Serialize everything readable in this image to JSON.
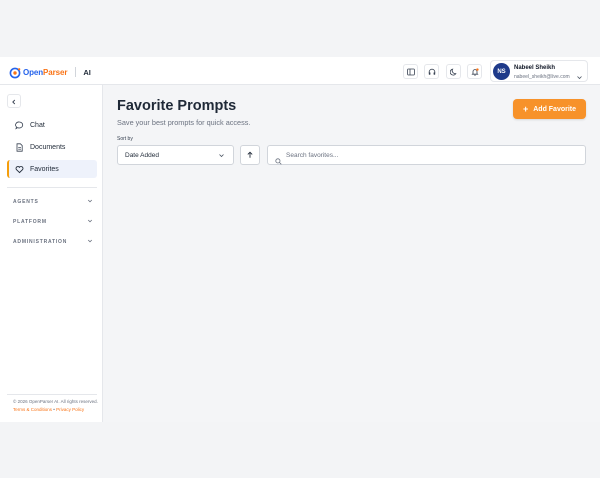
{
  "brand": {
    "name_open": "Open",
    "name_parser": "Parser",
    "suffix": "AI"
  },
  "header": {
    "icons": [
      "layout-icon",
      "headset-icon",
      "moon-icon",
      "notification-bell-icon"
    ],
    "user": {
      "initials": "NS",
      "name": "Nabeel Sheikh",
      "email": "nabeel_sheikh@live.com"
    }
  },
  "sidebar": {
    "items": [
      {
        "label": "Chat",
        "icon": "chat-bubble-icon"
      },
      {
        "label": "Documents",
        "icon": "document-icon"
      },
      {
        "label": "Favorites",
        "icon": "heart-icon",
        "active": true
      }
    ],
    "sections": [
      {
        "label": "AGENTS"
      },
      {
        "label": "PLATFORM"
      },
      {
        "label": "ADMINISTRATION"
      }
    ],
    "footer": {
      "copyright": "© 2026 OpenParser AI. All rights reserved.",
      "terms": "Terms & Conditions",
      "separator": "•",
      "privacy": "Privacy Policy"
    }
  },
  "main": {
    "title": "Favorite Prompts",
    "subtitle": "Save your best prompts for quick access.",
    "add_button": "Add Favorite",
    "sort_label": "Sort by",
    "sort_value": "Date Added",
    "search_placeholder": "Search favorites..."
  },
  "colors": {
    "accent": "#f7922a",
    "brand_blue": "#2563eb",
    "avatar_bg": "#1e3a8a"
  }
}
